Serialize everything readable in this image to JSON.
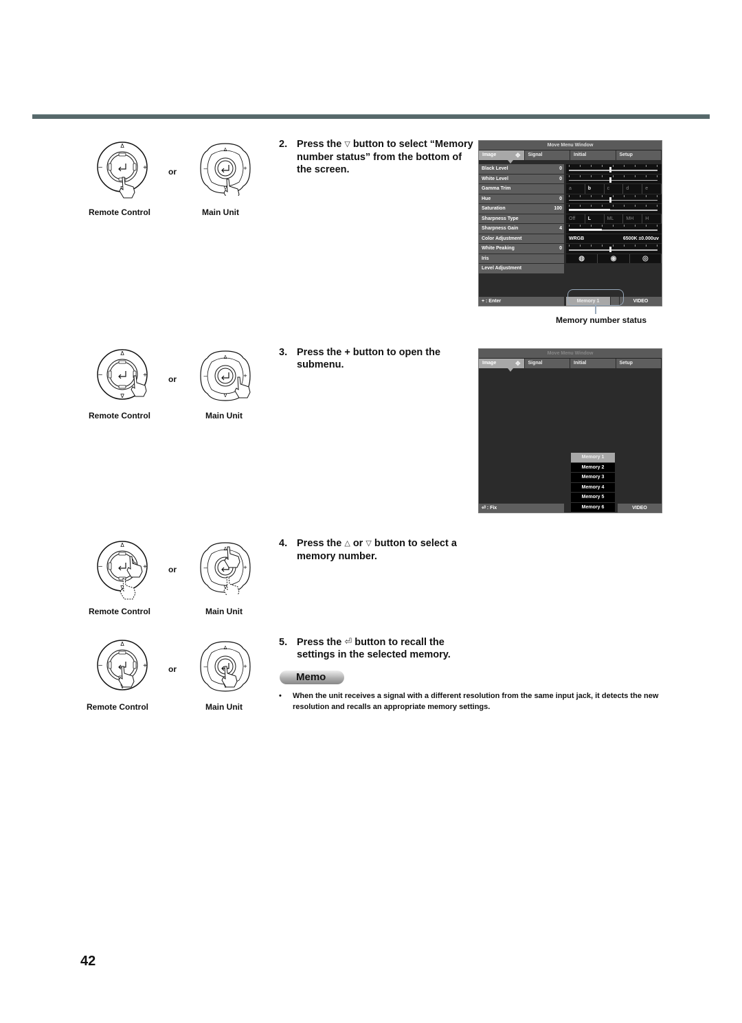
{
  "page_number": "42",
  "labels": {
    "remote_control": "Remote Control",
    "main_unit": "Main Unit",
    "or": "or"
  },
  "steps": [
    {
      "num": "2.",
      "pre": "Press the",
      "icon": "down-triangle",
      "glyph": "▽",
      "post": "button to select “Memory number status” from the bottom of the screen."
    },
    {
      "num": "3.",
      "text": "Press the + button to open the submenu."
    },
    {
      "num": "4.",
      "pre": "Press the",
      "icon1": "up-triangle",
      "glyph1": "△",
      "mid": "or",
      "icon2": "down-triangle",
      "glyph2": "▽",
      "post": "button to select a memory number."
    },
    {
      "num": "5.",
      "pre": "Press the",
      "icon": "enter",
      "glyph": "⏎",
      "post": "button to recall the settings in the selected memory."
    }
  ],
  "osd1": {
    "title": "Move Menu Window",
    "tabs": [
      "Image",
      "Signal",
      "Initial",
      "Setup"
    ],
    "active_tab": "Image",
    "rows": [
      {
        "label": "Black Level",
        "value": "0",
        "control": "slider",
        "level": 0.5
      },
      {
        "label": "White Level",
        "value": "0",
        "control": "slider",
        "level": 0.5
      },
      {
        "label": "Gamma Trim",
        "value": "",
        "control": "choices",
        "options": [
          "a",
          "b",
          "c",
          "d",
          "e"
        ],
        "selected": "b"
      },
      {
        "label": "Hue",
        "value": "0",
        "control": "slider",
        "level": 0.5
      },
      {
        "label": "Saturation",
        "value": "100",
        "control": "fill",
        "level": 0.5
      },
      {
        "label": "Sharpness Type",
        "value": "",
        "control": "choices",
        "options": [
          "Off",
          "L",
          "ML",
          "MH",
          "H"
        ],
        "selected": "L"
      },
      {
        "label": "Sharpness Gain",
        "value": "4",
        "control": "fill",
        "level": 0.4
      },
      {
        "label": "Color Adjustment",
        "value": "",
        "control": "wrgb",
        "left": "WRGB",
        "right": "6500K ±0.000uv"
      },
      {
        "label": "White Peaking",
        "value": "0",
        "control": "slider",
        "level": 0.5
      },
      {
        "label": "Iris",
        "value": "",
        "control": "iris",
        "options": [
          "◍",
          "◉",
          "◎"
        ]
      },
      {
        "label": "Level Adjustment",
        "value": "",
        "control": "none"
      }
    ],
    "status": {
      "enter": "+ : Enter",
      "memory": "Memory 1",
      "source": "VIDEO"
    },
    "callout_label": "Memory number status"
  },
  "osd2": {
    "title": "Move Menu Window",
    "tabs": [
      "Image",
      "Signal",
      "Initial",
      "Setup"
    ],
    "active_tab": "Image",
    "memories": [
      "Memory 1",
      "Memory 2",
      "Memory 3",
      "Memory 4",
      "Memory 5",
      "Memory 6"
    ],
    "selected_memory": "Memory 1",
    "status": {
      "fix": "⏎ : Fix",
      "source": "VIDEO"
    }
  },
  "memo": {
    "title": "Memo",
    "bullet": "When the unit receives a signal with a different resolution from the same input jack, it detects the new resolution and recalls an appropriate memory settings."
  },
  "colors": {
    "rule": "#56686a",
    "osd_bg": "#2b2b2b",
    "osd_label": "#5e5e5e",
    "osd_selected": "#a8a8a8"
  }
}
